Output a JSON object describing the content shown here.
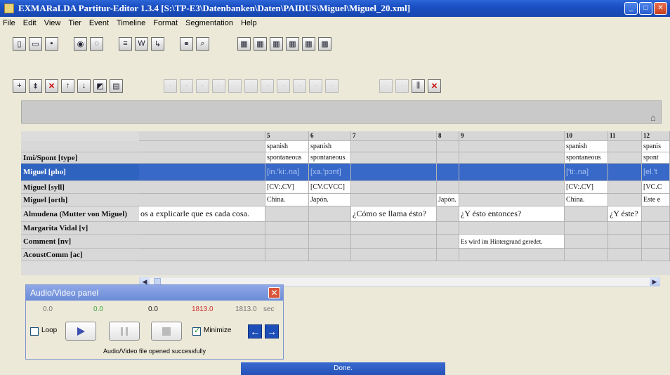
{
  "window": {
    "title": "EXMARaLDA Partitur-Editor 1.3.4 [S:\\TP-E3\\Datenbanken\\Daten\\PAIDUS\\Miguel\\Miguel_20.xml]"
  },
  "menu": [
    "File",
    "Edit",
    "View",
    "Tier",
    "Event",
    "Timeline",
    "Format",
    "Segmentation",
    "Help"
  ],
  "grid": {
    "columns": [
      "5",
      "6",
      "7",
      "8",
      "9",
      "10",
      "11",
      "12"
    ],
    "rows": [
      {
        "label": "",
        "cells": [
          "spanish",
          "spanish",
          "",
          "",
          "",
          "spanish",
          "",
          "spanis"
        ]
      },
      {
        "label": "Imi/Spont [type]",
        "cells": [
          "spontaneous",
          "spontaneous",
          "",
          "",
          "",
          "spontaneous",
          "",
          "spont"
        ]
      },
      {
        "label": "Miguel [pho]",
        "selected": true,
        "cells": [
          "[in.'ki:.na]",
          "[xa.'pɔnt]",
          "",
          "",
          "",
          "['ti:.na]",
          "",
          "[el.'t"
        ]
      },
      {
        "label": "Miguel [syll]",
        "cells": [
          "[CV:.CV]",
          "[CV.CVCC]",
          "",
          "",
          "",
          "[CV:.CV]",
          "",
          "[VC.C"
        ]
      },
      {
        "label": "Miguel [orth]",
        "cells": [
          "China.",
          "Japón.",
          "",
          "Japón.",
          "",
          "China.",
          "",
          "Este e"
        ]
      },
      {
        "label": "Almudena (Mutter von Miguel)",
        "cells": [
          "¿Cómo se llama ésto?",
          "",
          "¿Y ésto entonces?",
          "¿Y éste?"
        ],
        "lead": "os a explicarle que es cada cosa."
      },
      {
        "label": "Margarita Vidal [v]",
        "cells": []
      },
      {
        "label": "Comment [nv]",
        "cells": [
          "Es wird im Hintergrund geredet."
        ]
      },
      {
        "label": "AcoustComm [ac]",
        "cells": []
      }
    ]
  },
  "av_panel": {
    "title": "Audio/Video panel",
    "times": [
      "0.0",
      "0.0",
      "0.0",
      "1813.0",
      "1813.0",
      "sec"
    ],
    "loop_label": "Loop",
    "minimize_label": "Minimize",
    "status": "Audio/Video file opened successfully"
  },
  "statusbar": {
    "text": "Done."
  },
  "colors": {
    "title_bar": "#1a4fc2",
    "selected_row": "#2f63c0",
    "time_green": "#3fa63f",
    "time_red": "#d03030"
  }
}
